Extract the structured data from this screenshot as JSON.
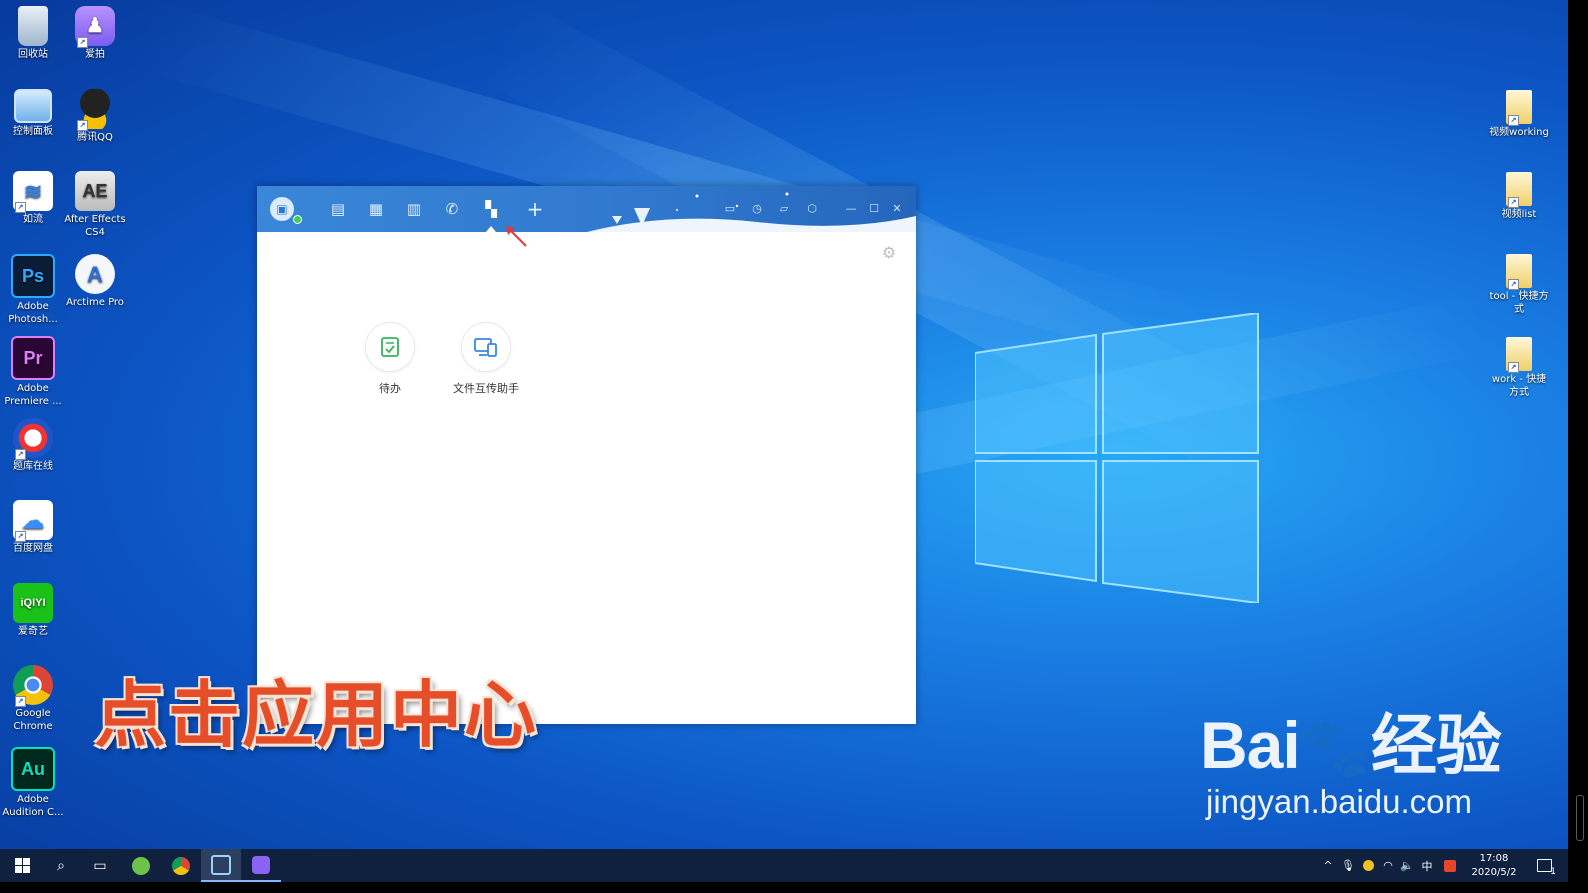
{
  "desktop": {
    "icons_left": [
      {
        "label": "回收站",
        "icon": "recycle-bin-icon"
      },
      {
        "label": "爱拍",
        "icon": "aipai-icon"
      },
      {
        "label": "控制面板",
        "icon": "control-panel-icon"
      },
      {
        "label": "腾讯QQ",
        "icon": "qq-icon"
      },
      {
        "label": "如流",
        "icon": "ruliu-icon"
      },
      {
        "label": "After Effects CS4",
        "icon": "after-effects-icon",
        "glyph": "AE"
      },
      {
        "label": "Adobe Photosh...",
        "icon": "photoshop-icon",
        "glyph": "Ps"
      },
      {
        "label": "Arctime Pro",
        "icon": "arctime-icon",
        "glyph": "A"
      },
      {
        "label": "Adobe Premiere ...",
        "icon": "premiere-icon",
        "glyph": "Pr"
      },
      {
        "label": "题库在线",
        "icon": "tiku-icon"
      },
      {
        "label": "百度网盘",
        "icon": "baidu-netdisk-icon"
      },
      {
        "label": "爱奇艺",
        "icon": "iqiyi-icon",
        "glyph": "iQIYI"
      },
      {
        "label": "Google Chrome",
        "icon": "chrome-icon"
      },
      {
        "label": "Adobe Audition C...",
        "icon": "audition-icon",
        "glyph": "Au"
      }
    ],
    "icons_right": [
      {
        "label": "视频working",
        "icon": "folder-icon"
      },
      {
        "label": "视频list",
        "icon": "folder-icon"
      },
      {
        "label": "tool - 快捷方式",
        "icon": "folder-shortcut-icon"
      },
      {
        "label": "work - 快捷方式",
        "icon": "folder-shortcut-icon"
      }
    ]
  },
  "app": {
    "toolbar_icons": [
      "avatar-icon",
      "message-icon",
      "calendar-icon",
      "contacts-icon",
      "phone-icon",
      "app-center-icon",
      "add-icon"
    ],
    "toolbar_right_icons": [
      "note-icon",
      "history-icon",
      "folder-icon",
      "settings-hex-icon"
    ],
    "window_controls": [
      "minimize-icon",
      "maximize-icon",
      "close-icon"
    ],
    "apps": [
      {
        "label": "待办",
        "icon": "todo-icon"
      },
      {
        "label": "文件互传助手",
        "icon": "file-transfer-icon"
      }
    ]
  },
  "caption": "点击应用中心",
  "watermark": {
    "logo": "Bai du 经验",
    "logo_a": "Bai",
    "logo_b": "经验",
    "url": "jingyan.baidu.com"
  },
  "taskbar": {
    "time": "17:08",
    "date": "2020/5/2",
    "ime": "中",
    "notification_count": "1"
  },
  "colors": {
    "accent": "#2f78ce",
    "caption": "#e64e2a",
    "taskbar": "#10213f"
  }
}
